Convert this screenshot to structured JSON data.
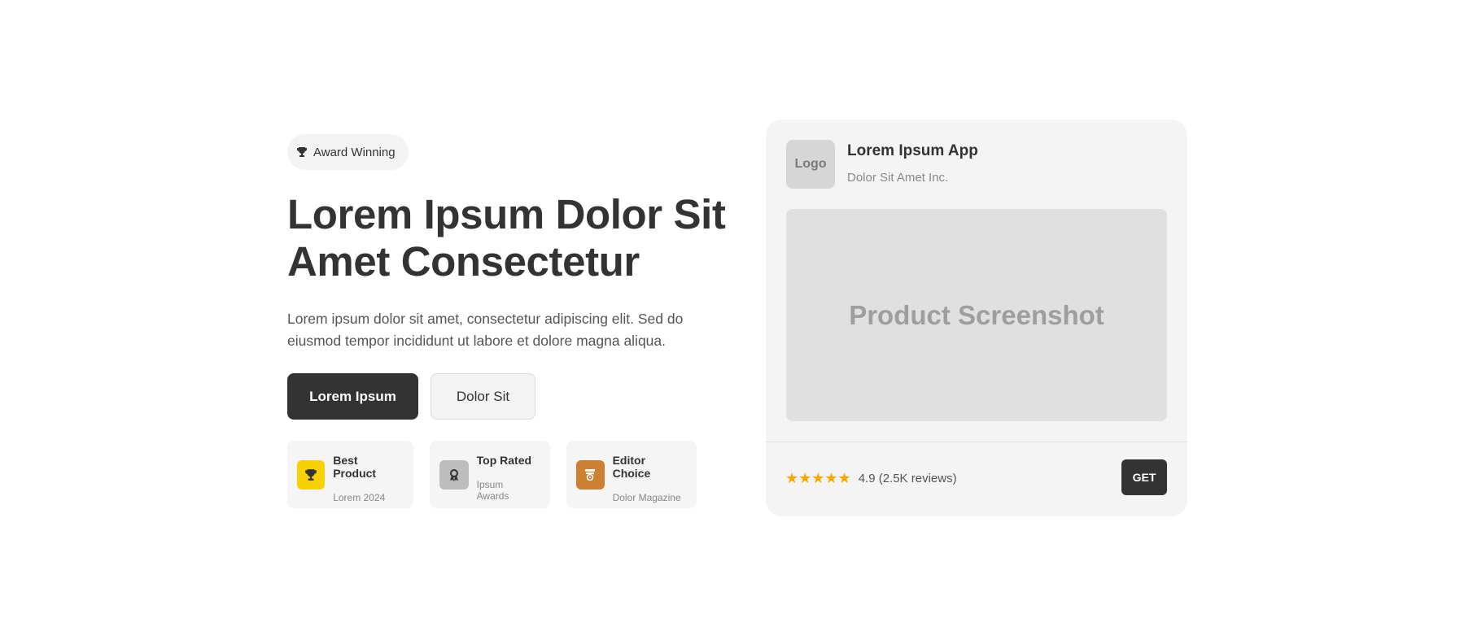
{
  "hero": {
    "badge_label": "Award Winning",
    "headline_line1": "Lorem Ipsum Dolor Sit",
    "headline_line2": "Amet Consectetur",
    "description": "Lorem ipsum dolor sit amet, consectetur adipiscing elit. Sed do eiusmod tempor incididunt ut labore et dolore magna aliqua.",
    "primary_button": "Lorem Ipsum",
    "secondary_button": "Dolor Sit"
  },
  "awards": [
    {
      "title": "Best Product",
      "subtitle": "Lorem 2024",
      "icon": "trophy-icon",
      "color": "#f7d200"
    },
    {
      "title": "Top Rated",
      "subtitle": "Ipsum Awards",
      "icon": "medal-icon",
      "color": "#bdbdbd"
    },
    {
      "title": "Editor Choice",
      "subtitle": "Dolor Magazine",
      "icon": "editor-badge-icon",
      "color": "#cd7f32"
    }
  ],
  "card": {
    "logo_label": "Logo",
    "app_name": "Lorem Ipsum App",
    "company": "Dolor Sit Amet Inc.",
    "screenshot_label": "Product Screenshot",
    "stars": "★★★★★",
    "rating_text": "4.9 (2.5K reviews)",
    "get_button": "GET"
  },
  "colors": {
    "primary": "#333333",
    "star": "#f5a800",
    "card_bg": "#f4f4f4"
  }
}
